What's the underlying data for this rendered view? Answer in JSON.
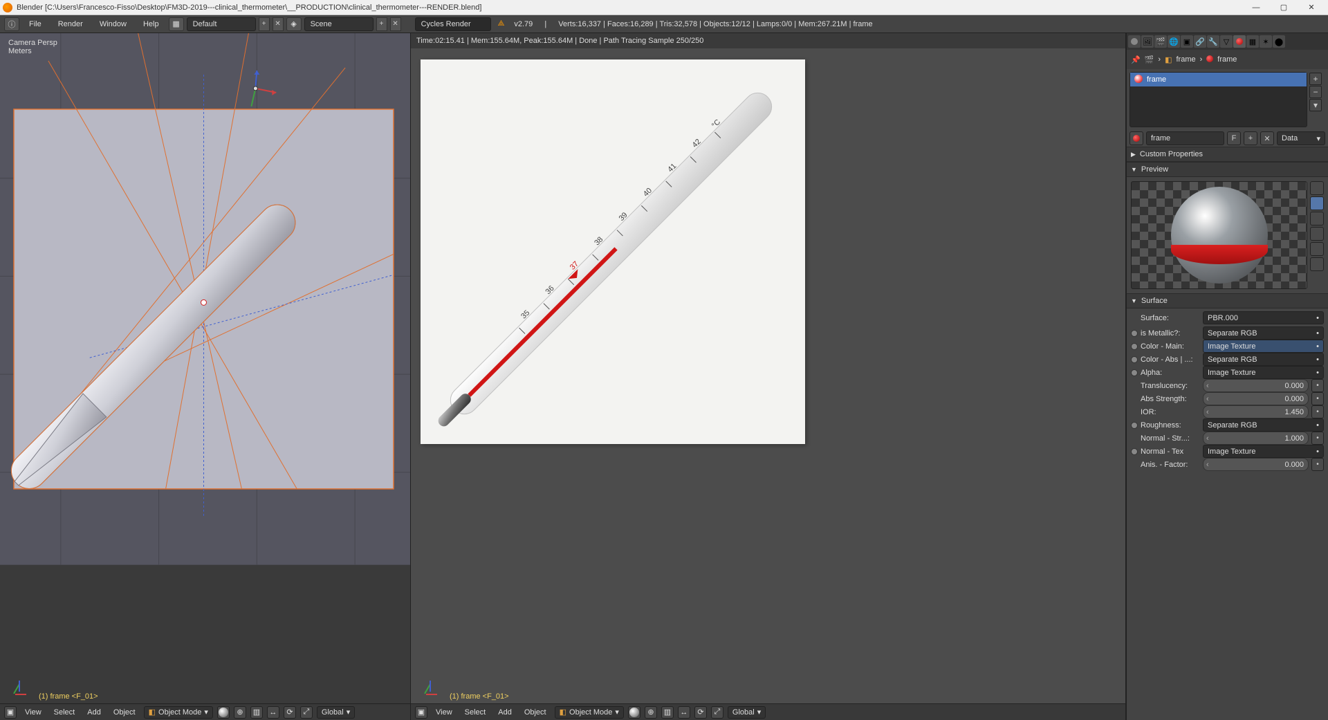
{
  "window": {
    "title": "Blender [C:\\Users\\Francesco-Fisso\\Desktop\\FM3D-2019---clinical_thermometer\\__PRODUCTION\\clinical_thermometer---RENDER.blend]"
  },
  "topbar": {
    "menus": [
      "File",
      "Render",
      "Window",
      "Help"
    ],
    "layout": "Default",
    "scene": "Scene",
    "engine": "Cycles Render",
    "version": "v2.79",
    "stats": "Verts:16,337 | Faces:16,289 | Tris:32,578 | Objects:12/12 | Lamps:0/0 | Mem:267.21M | frame"
  },
  "viewport3d": {
    "overlay_line1": "Camera Persp",
    "overlay_line2": "Meters",
    "selection_label": "(1) frame <F_01>",
    "header": {
      "menus": [
        "View",
        "Select",
        "Add",
        "Object"
      ],
      "mode": "Object Mode",
      "orientation": "Global"
    }
  },
  "render_view": {
    "status": "Time:02:15.41 | Mem:155.64M, Peak:155.64M | Done | Path Tracing Sample 250/250",
    "selection_label": "(1) frame <F_01>",
    "header": {
      "menus": [
        "View",
        "Select",
        "Add",
        "Object"
      ],
      "mode": "Object Mode",
      "orientation": "Global"
    }
  },
  "properties": {
    "breadcrumb_obj": "frame",
    "breadcrumb_mat": "frame",
    "material_list": [
      {
        "name": "frame"
      }
    ],
    "material_name": "frame",
    "material_F": "F",
    "data_menu": "Data",
    "sections": {
      "custom_props": "Custom Properties",
      "preview": "Preview",
      "surface": "Surface"
    },
    "surface": {
      "surface_label": "Surface:",
      "surface_value": "PBR.000",
      "rows": [
        {
          "dot": true,
          "label": "is Metallic?:",
          "value": "Separate RGB",
          "type": "sel"
        },
        {
          "dot": true,
          "label": "Color - Main:",
          "value": "Image Texture",
          "type": "sel_hl"
        },
        {
          "dot": true,
          "label": "Color - Abs | ...:",
          "value": "Separate RGB",
          "type": "sel"
        },
        {
          "dot": true,
          "label": "Alpha:",
          "value": "Image Texture",
          "type": "sel"
        },
        {
          "dot": false,
          "label": "Translucency:",
          "value": "0.000",
          "type": "num"
        },
        {
          "dot": false,
          "label": "Abs Strength:",
          "value": "0.000",
          "type": "num"
        },
        {
          "dot": false,
          "label": "IOR:",
          "value": "1.450",
          "type": "num"
        },
        {
          "dot": true,
          "label": "Roughness:",
          "value": "Separate RGB",
          "type": "sel"
        },
        {
          "dot": false,
          "label": "Normal - Str...:",
          "value": "1.000",
          "type": "num"
        },
        {
          "dot": true,
          "label": "Normal - Tex",
          "value": "Image Texture",
          "type": "sel"
        },
        {
          "dot": false,
          "label": "Anis. - Factor:",
          "value": "0.000",
          "type": "num"
        }
      ]
    }
  }
}
